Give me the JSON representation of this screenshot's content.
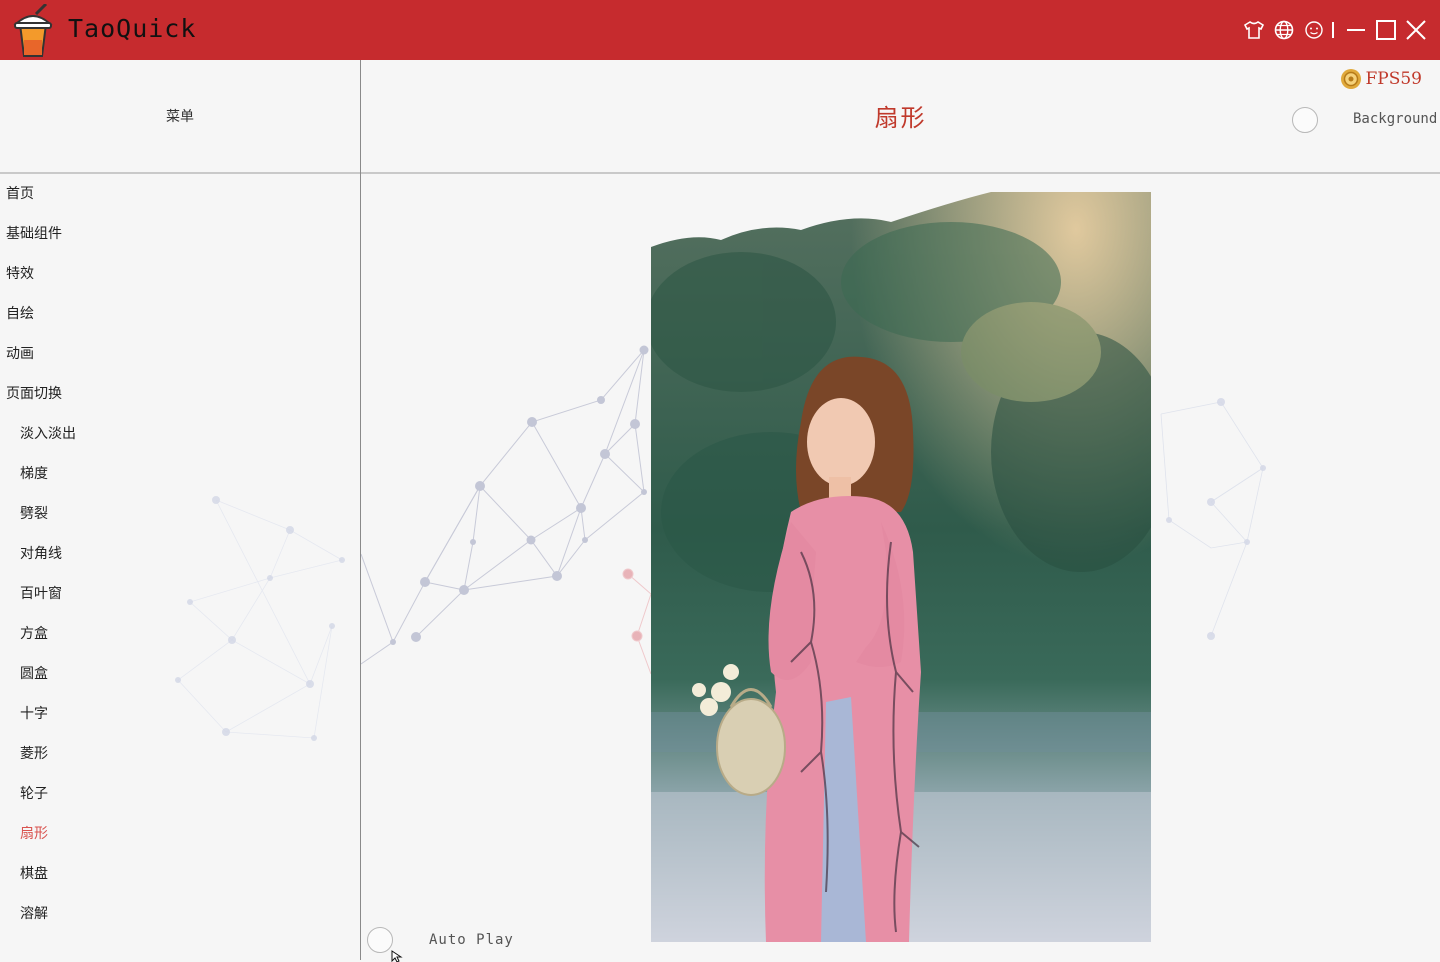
{
  "app": {
    "title": "TaoQuick"
  },
  "titlebar_icons": [
    "skin-icon",
    "language-icon",
    "feedback-icon",
    "minimize-icon",
    "maximize-icon",
    "close-icon"
  ],
  "menu": {
    "header": "菜单",
    "active": "扇形",
    "items": [
      {
        "label": "首页",
        "sub": false
      },
      {
        "label": "基础组件",
        "sub": false
      },
      {
        "label": "特效",
        "sub": false
      },
      {
        "label": "自绘",
        "sub": false
      },
      {
        "label": "动画",
        "sub": false
      },
      {
        "label": "页面切换",
        "sub": false
      },
      {
        "label": "淡入淡出",
        "sub": true
      },
      {
        "label": "梯度",
        "sub": true
      },
      {
        "label": "劈裂",
        "sub": true
      },
      {
        "label": "对角线",
        "sub": true
      },
      {
        "label": "百叶窗",
        "sub": true
      },
      {
        "label": "方盒",
        "sub": true
      },
      {
        "label": "圆盒",
        "sub": true
      },
      {
        "label": "十字",
        "sub": true
      },
      {
        "label": "菱形",
        "sub": true
      },
      {
        "label": "轮子",
        "sub": true
      },
      {
        "label": "扇形",
        "sub": true
      },
      {
        "label": "棋盘",
        "sub": true
      },
      {
        "label": "溶解",
        "sub": true
      }
    ]
  },
  "content": {
    "title": "扇形",
    "fps_label": "FPS59",
    "background_label": "Background",
    "autoplay_label": "Auto Play"
  },
  "colors": {
    "titlebar": "#c62b2e",
    "accent": "#c0392b",
    "background": "#f6f6f6"
  }
}
